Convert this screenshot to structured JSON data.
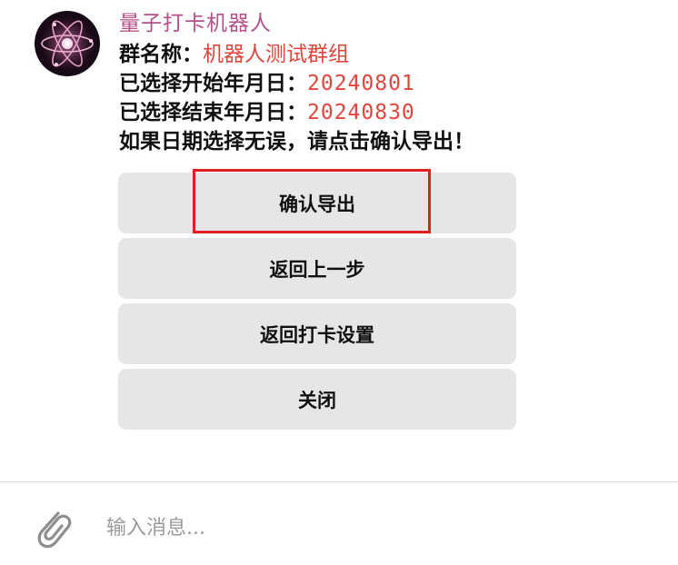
{
  "bot": {
    "name": "量子打卡机器人",
    "avatar_icon": "atom-icon"
  },
  "message": {
    "group_label": "群名称：",
    "group_value": "机器人测试群组",
    "start_label": "已选择开始年月日：",
    "start_value": "20240801",
    "end_label": "已选择结束年月日：",
    "end_value": "20240830",
    "instruction": "如果日期选择无误，请点击确认导出！"
  },
  "buttons": {
    "confirm_export": "确认导出",
    "back_step": "返回上一步",
    "back_settings": "返回打卡设置",
    "close": "关闭"
  },
  "composer": {
    "placeholder": "输入消息...",
    "attach_icon": "paperclip-icon"
  },
  "colors": {
    "sender_name": "#b5508a",
    "value_text": "#e0463c",
    "button_bg": "#e6e6e6",
    "highlight": "#e02020"
  }
}
